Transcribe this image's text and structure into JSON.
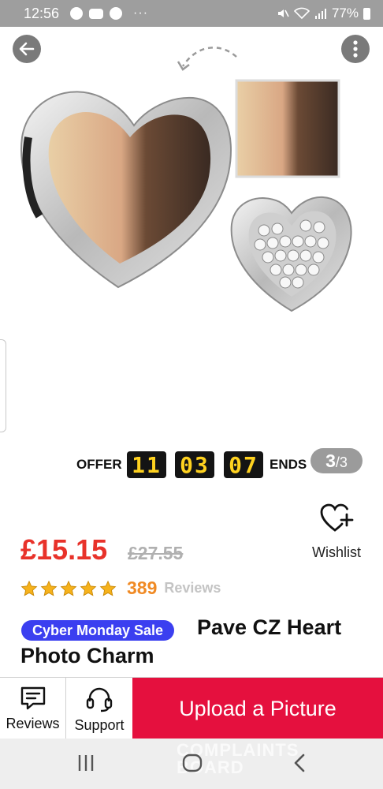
{
  "status_bar": {
    "time": "12:56",
    "notification_icons": [
      "facebook-icon",
      "youtube-icon",
      "messenger-icon"
    ],
    "overflow": "···",
    "battery_percent": "77%"
  },
  "hero": {
    "back_icon": "arrow-left-icon",
    "more_icon": "more-vertical-icon"
  },
  "offer": {
    "label": "OFFER",
    "hours": "11",
    "minutes": "03",
    "seconds": "07",
    "ends_label": "ENDS"
  },
  "gallery": {
    "current": "3",
    "separator": "/",
    "total": "3"
  },
  "product": {
    "price": "£15.15",
    "old_price": "£27.55",
    "rating_stars": 5,
    "review_count": "389",
    "review_word": "Reviews",
    "sale_badge": "Cyber Monday Sale",
    "title_line1": "Pave CZ Heart",
    "title_line2": "Photo Charm"
  },
  "wishlist": {
    "label": "Wishlist",
    "icon": "heart-plus-icon"
  },
  "actions": {
    "reviews_label": "Reviews",
    "support_label": "Support",
    "upload_label": "Upload a Picture"
  },
  "colors": {
    "price_red": "#e8322a",
    "upload_red": "#e5103e",
    "sale_blue": "#3b3ff0",
    "review_orange": "#f08a24",
    "countdown_yellow": "#ffd21f"
  },
  "watermark": {
    "line1": "COMPLAINTS",
    "line2": "BOARD"
  }
}
